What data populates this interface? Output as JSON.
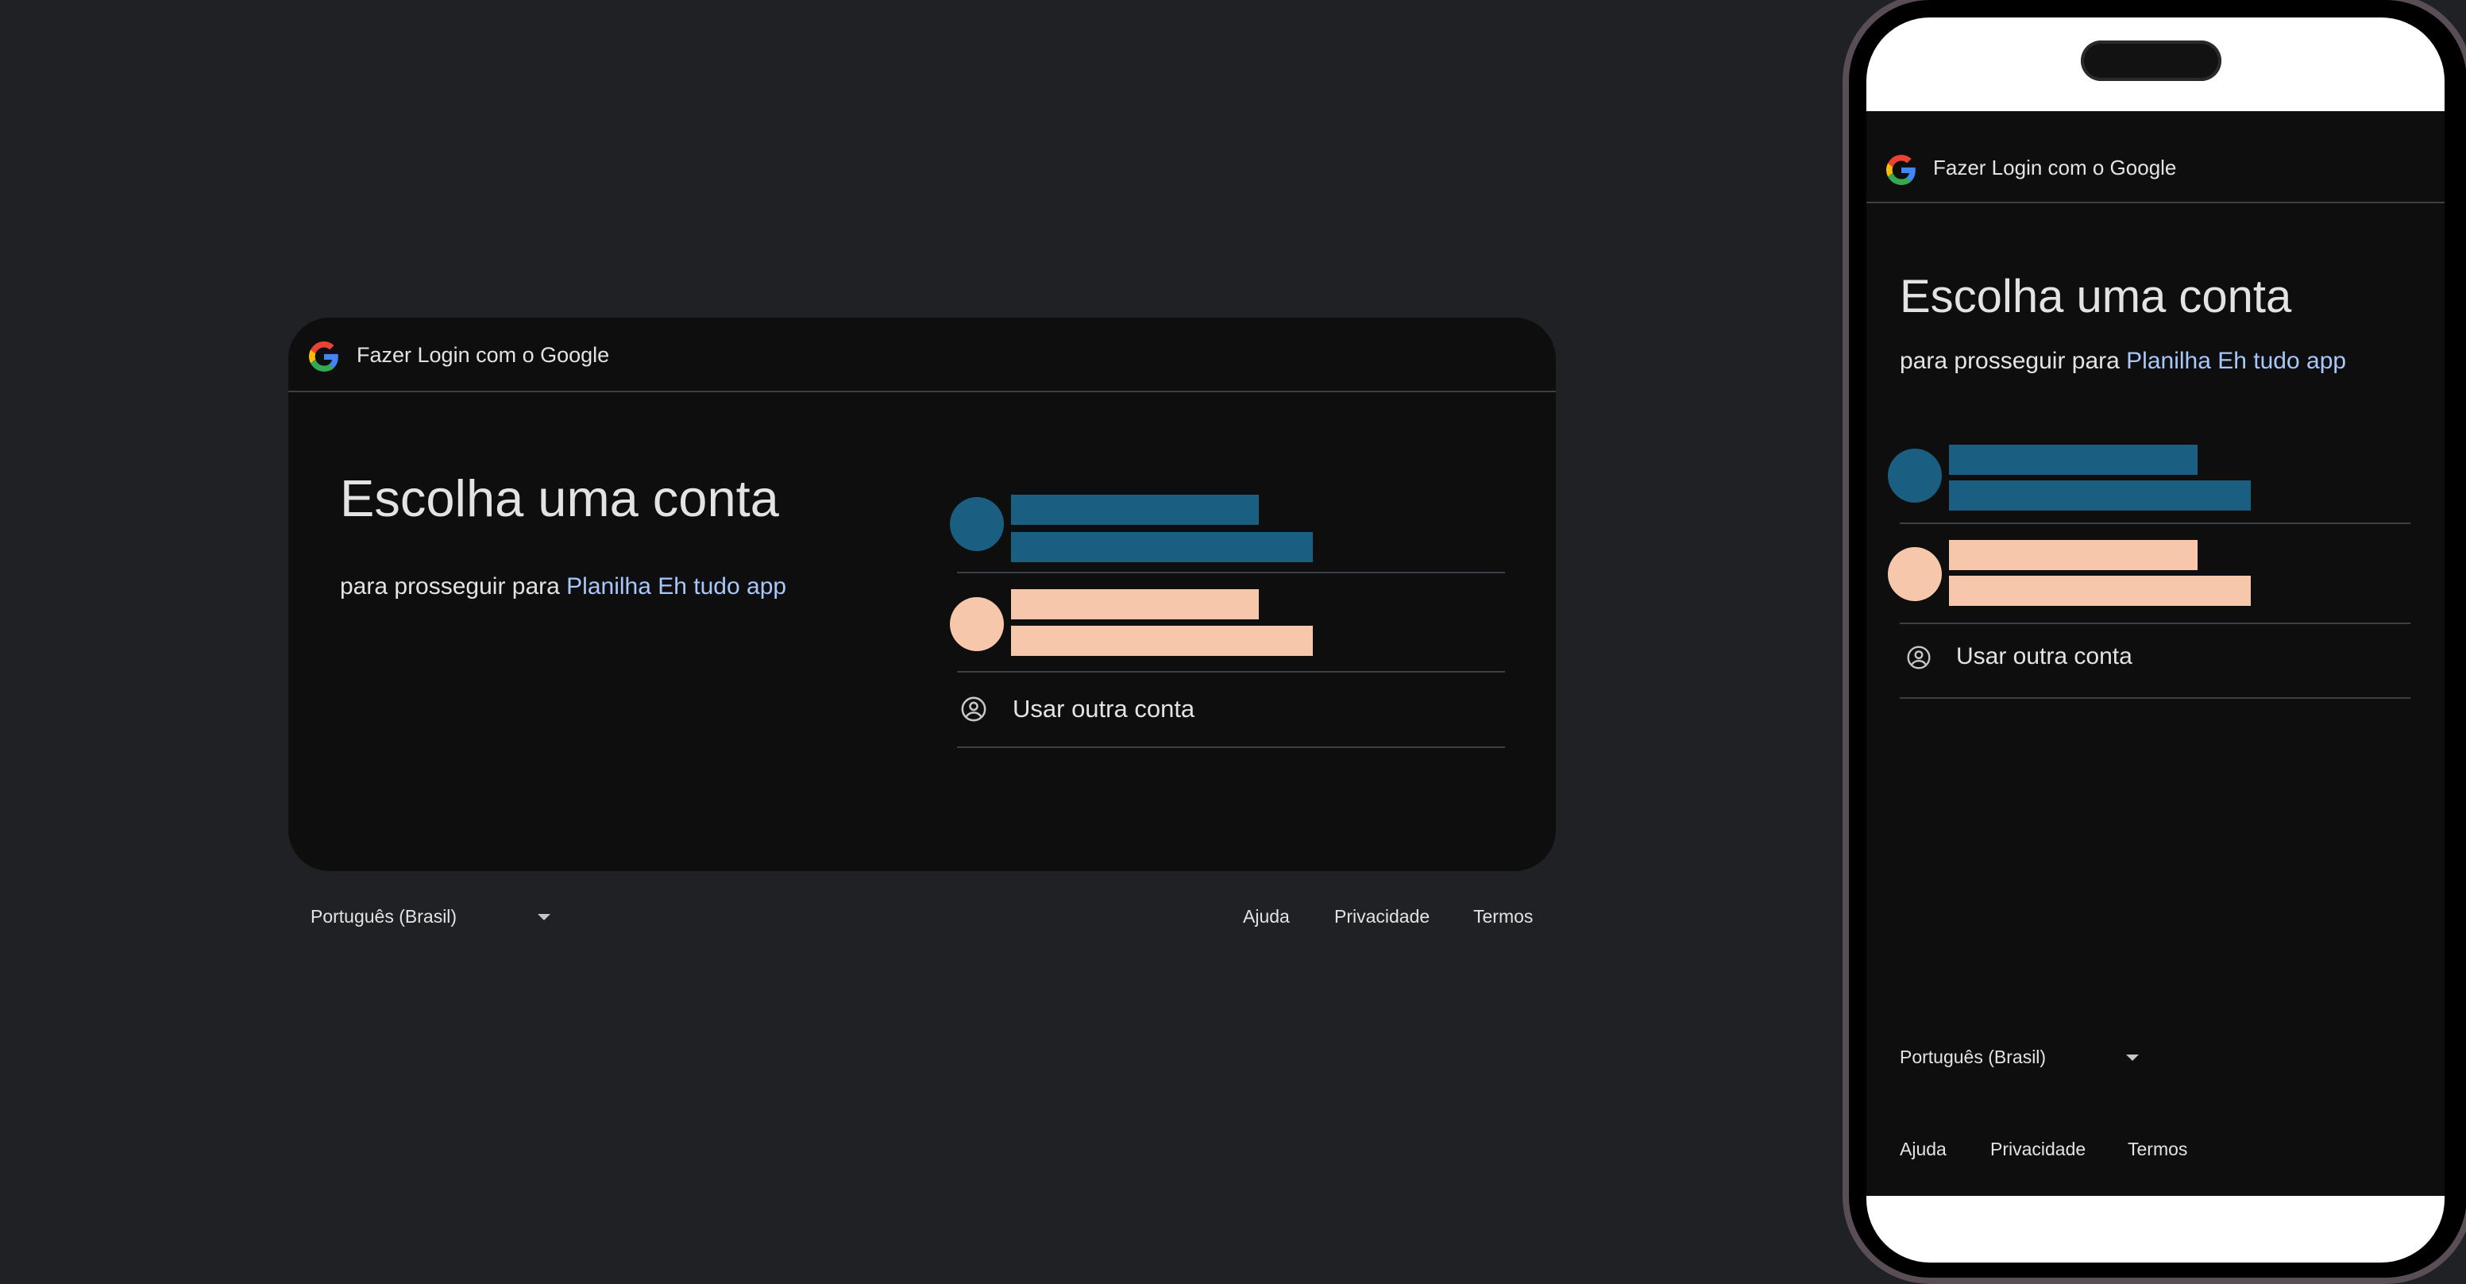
{
  "header": {
    "title": "Fazer Login com o Google"
  },
  "main": {
    "title": "Escolha uma conta",
    "subtitle_prefix": "para prosseguir para",
    "app_name": "Planilha Eh tudo app",
    "use_other_account": "Usar outra conta"
  },
  "accounts": [
    {
      "avatar_color": "#1a5f82",
      "redacted": true
    },
    {
      "avatar_color": "#f7c7ac",
      "redacted": true
    }
  ],
  "footer": {
    "language": "Português (Brasil)",
    "links": [
      "Ajuda",
      "Privacidade",
      "Termos"
    ]
  },
  "colors": {
    "background": "#202124",
    "card": "#0e0e0e",
    "link": "#a8c7fa",
    "divider": "#3c4043"
  }
}
